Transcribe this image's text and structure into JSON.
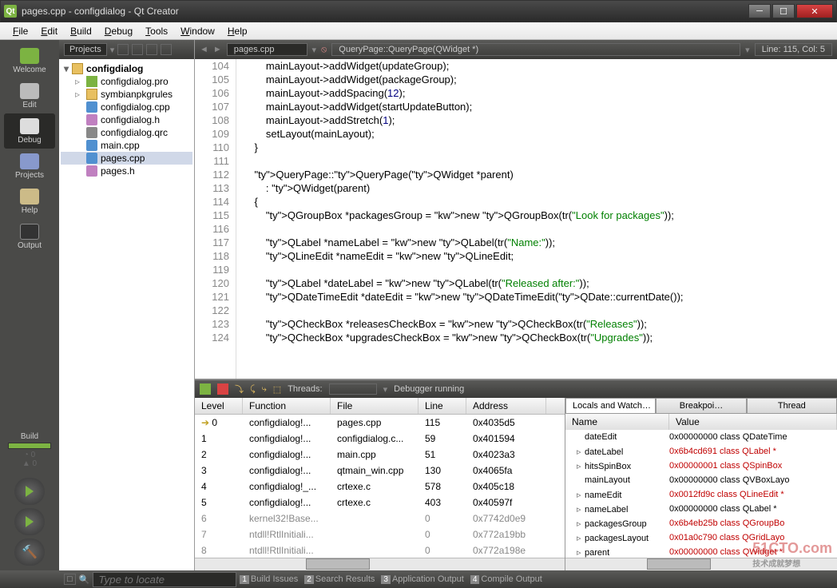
{
  "window": {
    "title": "pages.cpp - configdialog - Qt Creator"
  },
  "menu": [
    "File",
    "Edit",
    "Build",
    "Debug",
    "Tools",
    "Window",
    "Help"
  ],
  "sidebar": {
    "items": [
      {
        "label": "Welcome",
        "icon": "welcome"
      },
      {
        "label": "Edit",
        "icon": "edit"
      },
      {
        "label": "Debug",
        "icon": "debug"
      },
      {
        "label": "Projects",
        "icon": "proj"
      },
      {
        "label": "Help",
        "icon": "help"
      },
      {
        "label": "Output",
        "icon": "output"
      }
    ],
    "build_label": "Build"
  },
  "projects_toolbar": {
    "label": "Projects"
  },
  "tree": {
    "root": "configdialog",
    "items": [
      {
        "name": "configdialog.pro",
        "icon": "pro"
      },
      {
        "name": "symbianpkgrules",
        "icon": "folder"
      },
      {
        "name": "configdialog.cpp",
        "icon": "cpp"
      },
      {
        "name": "configdialog.h",
        "icon": "h"
      },
      {
        "name": "configdialog.qrc",
        "icon": "qrc"
      },
      {
        "name": "main.cpp",
        "icon": "cpp"
      },
      {
        "name": "pages.cpp",
        "icon": "cpp",
        "selected": true
      },
      {
        "name": "pages.h",
        "icon": "h"
      }
    ]
  },
  "editor": {
    "filename": "pages.cpp",
    "breadcrumb": "QueryPage::QueryPage(QWidget *)",
    "position": "Line: 115, Col: 5",
    "first_line": 104,
    "lines": [
      "        mainLayout->addWidget(updateGroup);",
      "        mainLayout->addWidget(packageGroup);",
      "        mainLayout->addSpacing(12);",
      "        mainLayout->addWidget(startUpdateButton);",
      "        mainLayout->addStretch(1);",
      "        setLayout(mainLayout);",
      "    }",
      "",
      "    QueryPage::QueryPage(QWidget *parent)",
      "        : QWidget(parent)",
      "    {",
      "        QGroupBox *packagesGroup = new QGroupBox(tr(\"Look for packages\"));",
      "",
      "        QLabel *nameLabel = new QLabel(tr(\"Name:\"));",
      "        QLineEdit *nameEdit = new QLineEdit;",
      "",
      "        QLabel *dateLabel = new QLabel(tr(\"Released after:\"));",
      "        QDateTimeEdit *dateEdit = new QDateTimeEdit(QDate::currentDate());",
      "",
      "        QCheckBox *releasesCheckBox = new QCheckBox(tr(\"Releases\"));",
      "        QCheckBox *upgradesCheckBox = new QCheckBox(tr(\"Upgrades\"));"
    ],
    "breakpoint_line": 115
  },
  "debug": {
    "threads_label": "Threads:",
    "status": "Debugger running",
    "stack": {
      "headers": [
        "Level",
        "Function",
        "File",
        "Line",
        "Address"
      ],
      "rows": [
        {
          "lvl": "0",
          "fn": "configdialog!...",
          "file": "pages.cpp",
          "line": "115",
          "addr": "0x4035d5",
          "current": true
        },
        {
          "lvl": "1",
          "fn": "configdialog!...",
          "file": "configdialog.c...",
          "line": "59",
          "addr": "0x401594"
        },
        {
          "lvl": "2",
          "fn": "configdialog!...",
          "file": "main.cpp",
          "line": "51",
          "addr": "0x4023a3"
        },
        {
          "lvl": "3",
          "fn": "configdialog!...",
          "file": "qtmain_win.cpp",
          "line": "130",
          "addr": "0x4065fa"
        },
        {
          "lvl": "4",
          "fn": "configdialog!_...",
          "file": "crtexe.c",
          "line": "578",
          "addr": "0x405c18"
        },
        {
          "lvl": "5",
          "fn": "configdialog!...",
          "file": "crtexe.c",
          "line": "403",
          "addr": "0x40597f"
        },
        {
          "lvl": "6",
          "fn": "kernel32!Base...",
          "file": "",
          "line": "0",
          "addr": "0x7742d0e9",
          "gray": true
        },
        {
          "lvl": "7",
          "fn": "ntdll!RtlInitiali...",
          "file": "",
          "line": "0",
          "addr": "0x772a19bb",
          "gray": true
        },
        {
          "lvl": "8",
          "fn": "ntdll!RtlInitiali...",
          "file": "",
          "line": "0",
          "addr": "0x772a198e",
          "gray": true
        }
      ]
    },
    "vars": {
      "tabs": [
        "Locals and Watch…",
        "Breakpoi…",
        "Thread"
      ],
      "headers": [
        "Name",
        "Value"
      ],
      "rows": [
        {
          "name": "dateEdit",
          "val": "0x00000000 class QDateTime",
          "red": false
        },
        {
          "name": "dateLabel",
          "val": "0x6b4cd691 class QLabel *",
          "red": true,
          "exp": true
        },
        {
          "name": "hitsSpinBox",
          "val": "0x00000001 class QSpinBox",
          "red": true,
          "exp": true
        },
        {
          "name": "mainLayout",
          "val": "0x00000000 class QVBoxLayo",
          "red": false
        },
        {
          "name": "nameEdit",
          "val": "0x0012fd9c class QLineEdit *",
          "red": true,
          "exp": true
        },
        {
          "name": "nameLabel",
          "val": "0x00000000 class QLabel *",
          "red": false,
          "exp": true
        },
        {
          "name": "packagesGroup",
          "val": "0x6b4eb25b class QGroupBo",
          "red": true,
          "exp": true
        },
        {
          "name": "packagesLayout",
          "val": "0x01a0c790 class QGridLayo",
          "red": true,
          "exp": true
        },
        {
          "name": "parent",
          "val": "0x00000000 class QWidget *",
          "red": true,
          "exp": true
        }
      ]
    }
  },
  "statusbar": {
    "search_placeholder": "Type to locate",
    "items": [
      "Build Issues",
      "Search Results",
      "Application Output",
      "Compile Output"
    ]
  },
  "watermark": {
    "big": "51CTO.com",
    "small": "技术成就梦想"
  }
}
